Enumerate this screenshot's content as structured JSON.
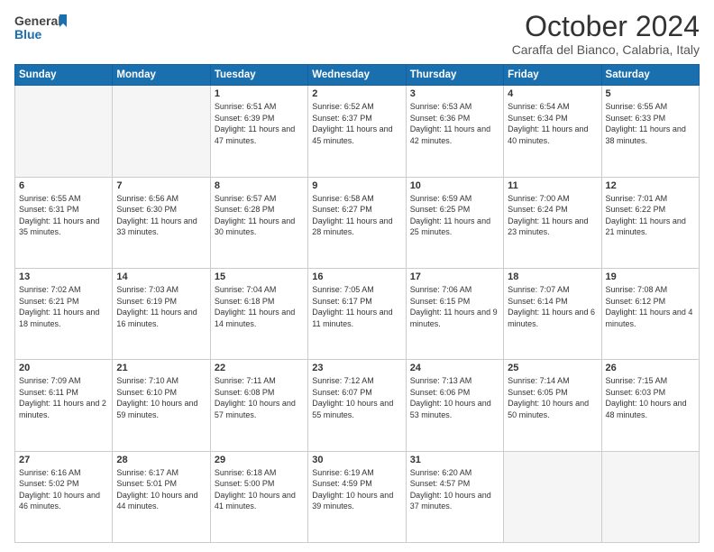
{
  "header": {
    "logo_line1": "General",
    "logo_line2": "Blue",
    "month": "October 2024",
    "location": "Caraffa del Bianco, Calabria, Italy"
  },
  "weekdays": [
    "Sunday",
    "Monday",
    "Tuesday",
    "Wednesday",
    "Thursday",
    "Friday",
    "Saturday"
  ],
  "weeks": [
    [
      {
        "day": "",
        "text": ""
      },
      {
        "day": "",
        "text": ""
      },
      {
        "day": "1",
        "text": "Sunrise: 6:51 AM\nSunset: 6:39 PM\nDaylight: 11 hours and 47 minutes."
      },
      {
        "day": "2",
        "text": "Sunrise: 6:52 AM\nSunset: 6:37 PM\nDaylight: 11 hours and 45 minutes."
      },
      {
        "day": "3",
        "text": "Sunrise: 6:53 AM\nSunset: 6:36 PM\nDaylight: 11 hours and 42 minutes."
      },
      {
        "day": "4",
        "text": "Sunrise: 6:54 AM\nSunset: 6:34 PM\nDaylight: 11 hours and 40 minutes."
      },
      {
        "day": "5",
        "text": "Sunrise: 6:55 AM\nSunset: 6:33 PM\nDaylight: 11 hours and 38 minutes."
      }
    ],
    [
      {
        "day": "6",
        "text": "Sunrise: 6:55 AM\nSunset: 6:31 PM\nDaylight: 11 hours and 35 minutes."
      },
      {
        "day": "7",
        "text": "Sunrise: 6:56 AM\nSunset: 6:30 PM\nDaylight: 11 hours and 33 minutes."
      },
      {
        "day": "8",
        "text": "Sunrise: 6:57 AM\nSunset: 6:28 PM\nDaylight: 11 hours and 30 minutes."
      },
      {
        "day": "9",
        "text": "Sunrise: 6:58 AM\nSunset: 6:27 PM\nDaylight: 11 hours and 28 minutes."
      },
      {
        "day": "10",
        "text": "Sunrise: 6:59 AM\nSunset: 6:25 PM\nDaylight: 11 hours and 25 minutes."
      },
      {
        "day": "11",
        "text": "Sunrise: 7:00 AM\nSunset: 6:24 PM\nDaylight: 11 hours and 23 minutes."
      },
      {
        "day": "12",
        "text": "Sunrise: 7:01 AM\nSunset: 6:22 PM\nDaylight: 11 hours and 21 minutes."
      }
    ],
    [
      {
        "day": "13",
        "text": "Sunrise: 7:02 AM\nSunset: 6:21 PM\nDaylight: 11 hours and 18 minutes."
      },
      {
        "day": "14",
        "text": "Sunrise: 7:03 AM\nSunset: 6:19 PM\nDaylight: 11 hours and 16 minutes."
      },
      {
        "day": "15",
        "text": "Sunrise: 7:04 AM\nSunset: 6:18 PM\nDaylight: 11 hours and 14 minutes."
      },
      {
        "day": "16",
        "text": "Sunrise: 7:05 AM\nSunset: 6:17 PM\nDaylight: 11 hours and 11 minutes."
      },
      {
        "day": "17",
        "text": "Sunrise: 7:06 AM\nSunset: 6:15 PM\nDaylight: 11 hours and 9 minutes."
      },
      {
        "day": "18",
        "text": "Sunrise: 7:07 AM\nSunset: 6:14 PM\nDaylight: 11 hours and 6 minutes."
      },
      {
        "day": "19",
        "text": "Sunrise: 7:08 AM\nSunset: 6:12 PM\nDaylight: 11 hours and 4 minutes."
      }
    ],
    [
      {
        "day": "20",
        "text": "Sunrise: 7:09 AM\nSunset: 6:11 PM\nDaylight: 11 hours and 2 minutes."
      },
      {
        "day": "21",
        "text": "Sunrise: 7:10 AM\nSunset: 6:10 PM\nDaylight: 10 hours and 59 minutes."
      },
      {
        "day": "22",
        "text": "Sunrise: 7:11 AM\nSunset: 6:08 PM\nDaylight: 10 hours and 57 minutes."
      },
      {
        "day": "23",
        "text": "Sunrise: 7:12 AM\nSunset: 6:07 PM\nDaylight: 10 hours and 55 minutes."
      },
      {
        "day": "24",
        "text": "Sunrise: 7:13 AM\nSunset: 6:06 PM\nDaylight: 10 hours and 53 minutes."
      },
      {
        "day": "25",
        "text": "Sunrise: 7:14 AM\nSunset: 6:05 PM\nDaylight: 10 hours and 50 minutes."
      },
      {
        "day": "26",
        "text": "Sunrise: 7:15 AM\nSunset: 6:03 PM\nDaylight: 10 hours and 48 minutes."
      }
    ],
    [
      {
        "day": "27",
        "text": "Sunrise: 6:16 AM\nSunset: 5:02 PM\nDaylight: 10 hours and 46 minutes."
      },
      {
        "day": "28",
        "text": "Sunrise: 6:17 AM\nSunset: 5:01 PM\nDaylight: 10 hours and 44 minutes."
      },
      {
        "day": "29",
        "text": "Sunrise: 6:18 AM\nSunset: 5:00 PM\nDaylight: 10 hours and 41 minutes."
      },
      {
        "day": "30",
        "text": "Sunrise: 6:19 AM\nSunset: 4:59 PM\nDaylight: 10 hours and 39 minutes."
      },
      {
        "day": "31",
        "text": "Sunrise: 6:20 AM\nSunset: 4:57 PM\nDaylight: 10 hours and 37 minutes."
      },
      {
        "day": "",
        "text": ""
      },
      {
        "day": "",
        "text": ""
      }
    ]
  ]
}
